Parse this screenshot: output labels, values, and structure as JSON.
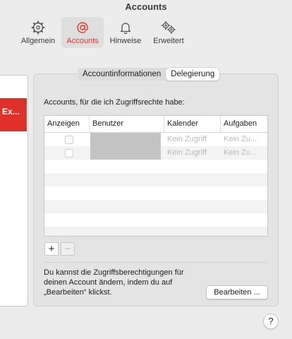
{
  "window": {
    "title": "Accounts"
  },
  "toolbar": {
    "items": [
      {
        "label": "Allgemein",
        "icon": "gear-icon"
      },
      {
        "label": "Accounts",
        "icon": "at-sign-icon",
        "active": true
      },
      {
        "label": "Hinweise",
        "icon": "bell-icon"
      },
      {
        "label": "Erweitert",
        "icon": "gears-icon"
      }
    ],
    "accent_color": "#e8352a"
  },
  "sidebar": {
    "selected_account": "Ex...",
    "selected_color": "#e0302a"
  },
  "tabs": [
    {
      "label": "Accountinformationen",
      "selected": false
    },
    {
      "label": "Delegierung",
      "selected": true
    }
  ],
  "delegation": {
    "description": "Accounts, für die ich Zugriffsrechte habe:",
    "columns": [
      "Anzeigen",
      "Benutzer",
      "Kalender",
      "Aufgaben"
    ],
    "rows": [
      {
        "show": false,
        "user": "",
        "calendar": "Kein Zugriff",
        "tasks": "Kein Zu..."
      },
      {
        "show": false,
        "user": "",
        "calendar": "Kein Zugriff",
        "tasks": "Kein Zu..."
      }
    ],
    "add_label": "+",
    "remove_label": "−",
    "footer_text": "Du kannst die Zugriffsberechtigungen für deinen Account ändern, indem du auf „Bearbeiten“ klickst.",
    "edit_label": "Bearbeiten ...",
    "help_label": "?"
  }
}
